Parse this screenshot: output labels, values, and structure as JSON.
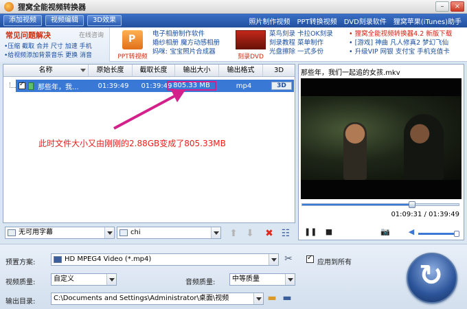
{
  "window": {
    "title": "狸窝全能视频转换器"
  },
  "tabs": [
    "添加视频",
    "视频编辑",
    "3D效果"
  ],
  "top_links": [
    "照片制作视频",
    "PPT转换视频",
    "DVD刻录软件",
    "狸窝苹果(iTunes)助手"
  ],
  "faq": {
    "title": "常见问题解决",
    "online": "在线咨询",
    "line1": "•压缩 截取 合并  尺寸 加速 手机",
    "line2": "•给视频添加背景音乐 更换 消音"
  },
  "ads": {
    "ppt_caption": "PPT转视频",
    "col1": [
      "电子相册制作软件",
      "婚纱相册  魔方动感相册",
      "妈咪: 宝宝照片合成器"
    ],
    "dvd_caption": "刻录DVD",
    "col2": [
      "菜鸟刻录  卡拉OK刻录",
      "刻录教程  菜单制作",
      "光盘擦除  一式多份"
    ],
    "col3": [
      "• 狸窝全能视频转换器4.2 新版下载",
      "• [游戏] 神曲  凡人修真2 梦幻飞仙",
      "• 升级VIP  网银  支付宝  手机充值卡"
    ]
  },
  "columns": [
    "名称",
    "原始长度",
    "截取长度",
    "输出大小",
    "输出格式",
    "3D"
  ],
  "file_row": {
    "name": "那些年，我...",
    "original_length": "01:39:49",
    "cut_length": "01:39:49",
    "output_size": "805.33 MB",
    "output_format": "mp4",
    "threed": "3D"
  },
  "annotation": "此时文件大小又由刚刚的2.88GB变成了805.33MB",
  "subtitle": {
    "subtitle_value": "无可用字幕",
    "audio_value": "chi"
  },
  "preview": {
    "title": "那些年，我们一起追的女孩.mkv",
    "time": "01:09:31 / 01:39:49",
    "progress": 0.7
  },
  "settings": {
    "preset_label": "预置方案:",
    "preset_value": "HD MPEG4 Video (*.mp4)",
    "apply_all": "应用到所有",
    "video_quality_label": "视频质量:",
    "video_quality_value": "自定义",
    "audio_quality_label": "音频质量:",
    "audio_quality_value": "中等质量",
    "output_dir_label": "输出目录:",
    "output_dir_value": "C:\\Documents and Settings\\Administrator\\桌面\\视频"
  },
  "colors": {
    "accent": "#3a78d6",
    "annotation": "#ee1c1c",
    "highlight_box": "#d4208a"
  }
}
